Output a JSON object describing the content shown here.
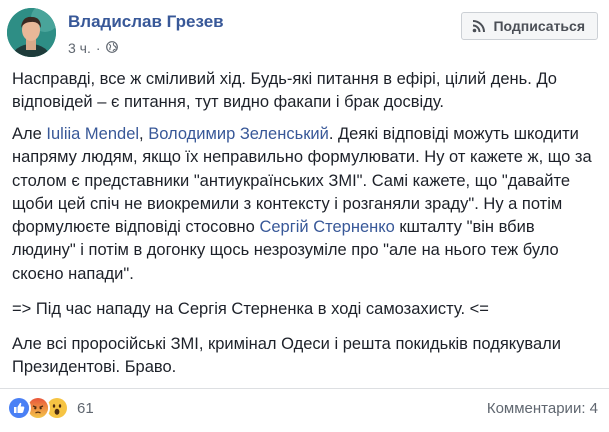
{
  "author": {
    "name": "Владислав Грезев",
    "time": "3 ч.",
    "subscribe_label": "Подписаться"
  },
  "post": {
    "p1": "Насправді, все ж сміливий хід. Будь-які питання в ефірі, цілий день. До відповідей – є питання, тут видно факапи і брак досвіду.",
    "p2": {
      "t1": "Але ",
      "link1": "Iuliia Mendel",
      "t2": ", ",
      "link2": "Володимир Зеленський",
      "t3": ". Деякі відповіді можуть шкодити напряму людям, якщо їх неправильно формулювати. Ну от кажете ж, що за столом є представники \"антиукраїнських ЗМІ\". Самі кажете, що \"давайте щоби цей спіч не виокремили з контексту і розганяли зраду\". Ну а потім формулюєте відповіді стосовно ",
      "link3": "Сергій Стерненко",
      "t4": " кшталту \"він вбив людину\" і потім в догонку щось незрозуміле про \"але на нього теж було скоєно напади\"."
    },
    "p3": "=> Під час нападу на Сергія Стерненка в ході самозахисту. <=",
    "p4": "Але всі проросійські ЗМІ, кримінал Одеси і решта покидьків подякували Президентові. Браво."
  },
  "footer": {
    "reactions": [
      "like",
      "angry",
      "wow"
    ],
    "reaction_count": "61",
    "comments_label": "Комментарии: 4"
  },
  "colors": {
    "link": "#385898",
    "text": "#1d2129",
    "meta": "#606770"
  }
}
